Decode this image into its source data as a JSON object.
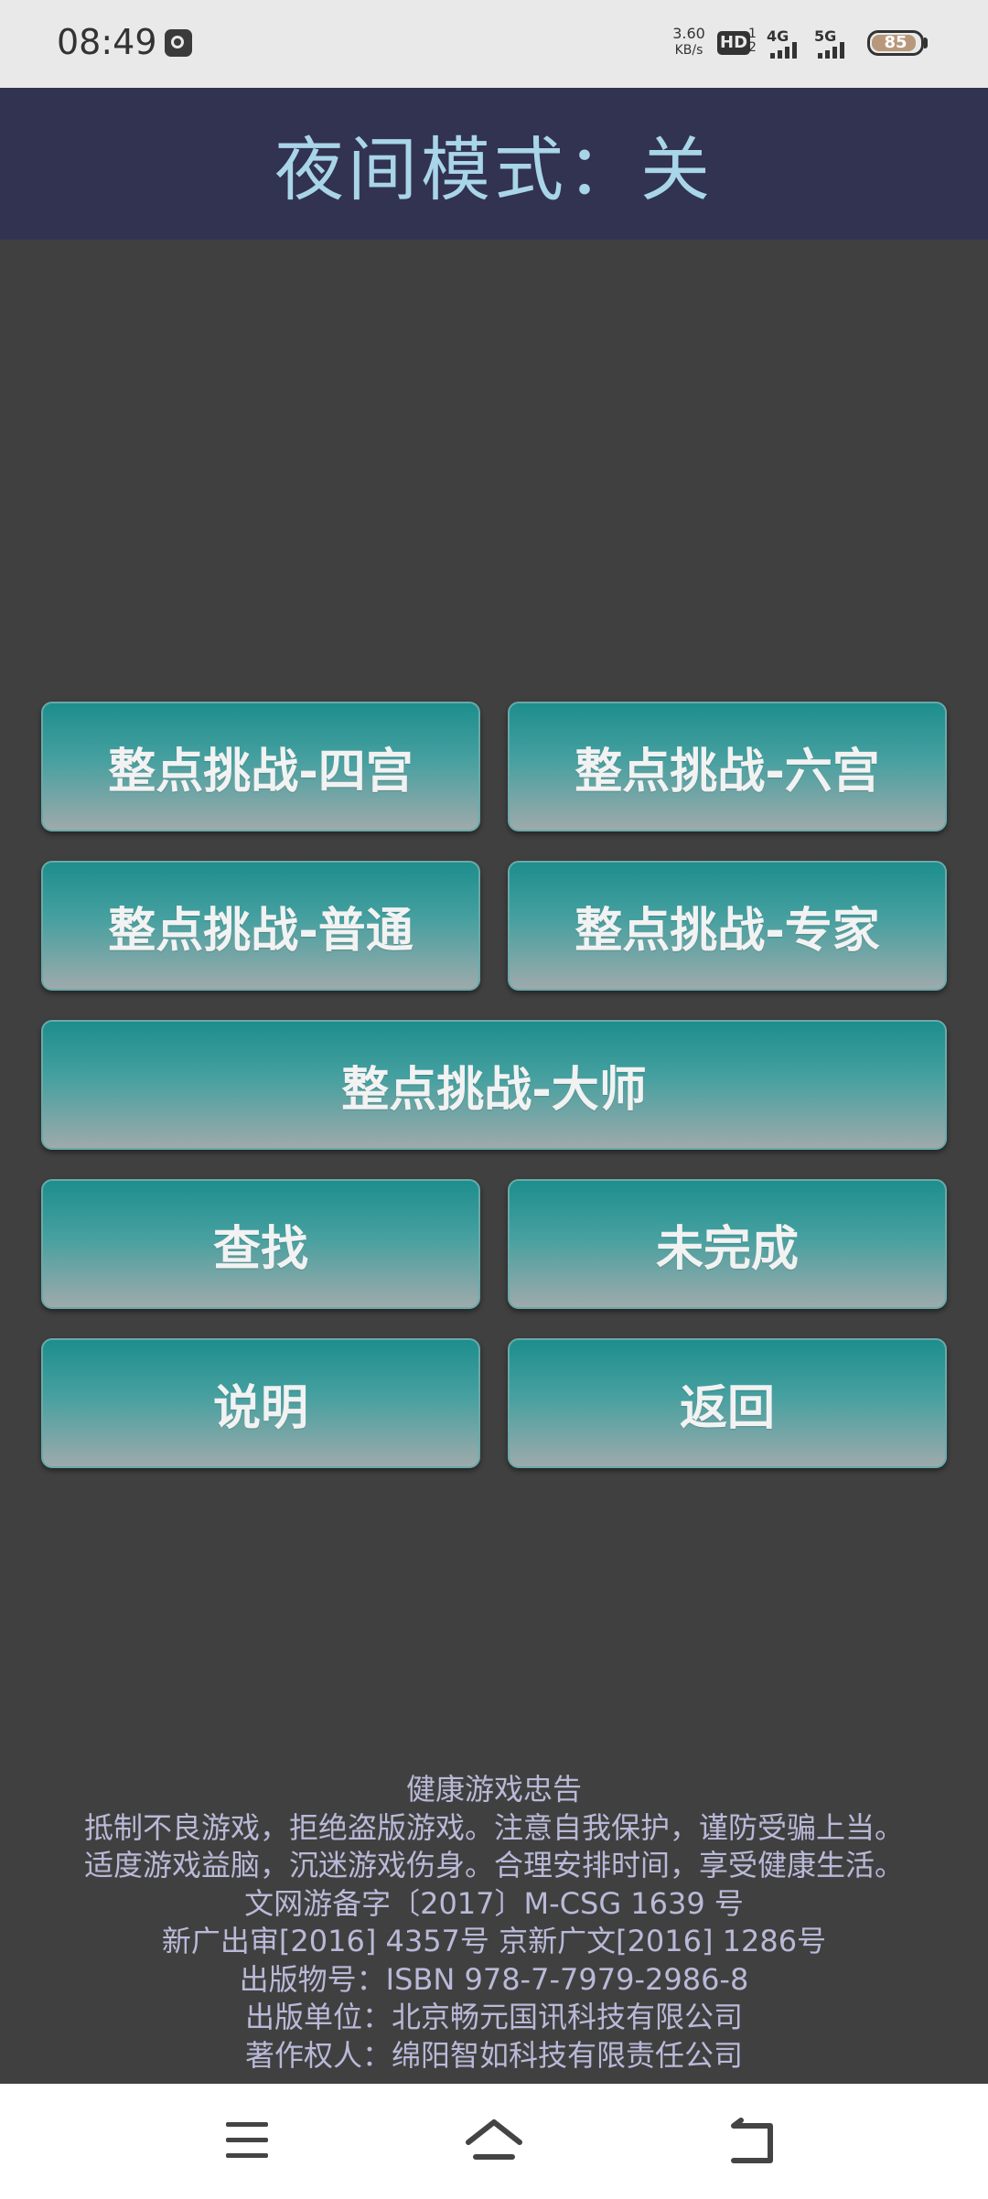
{
  "status_bar": {
    "time": "08:49",
    "net_speed_value": "3.60",
    "net_speed_unit": "KB/s",
    "hd_label": "HD",
    "hd_sub": "1\n2",
    "signal_4g": "4G",
    "signal_5g": "5G",
    "battery": "85",
    "app_icon": "gallery-icon"
  },
  "header": {
    "title": "夜间模式：关",
    "bg_color": "#323251",
    "title_color": "#a9d5e8"
  },
  "buttons": {
    "four_palace": "整点挑战-四宫",
    "six_palace": "整点挑战-六宫",
    "normal": "整点挑战-普通",
    "expert": "整点挑战-专家",
    "master": "整点挑战-大师",
    "search": "查找",
    "unfinished": "未完成",
    "instructions": "说明",
    "back": "返回"
  },
  "footer": {
    "lines": [
      "健康游戏忠告",
      "抵制不良游戏，拒绝盗版游戏。注意自我保护，谨防受骗上当。",
      "适度游戏益脑，沉迷游戏伤身。合理安排时间，享受健康生活。",
      "文网游备字〔2017〕M-CSG 1639 号",
      "新广出审[2016] 4357号 京新广文[2016] 1286号",
      "出版物号：ISBN 978-7-7979-2986-8",
      "出版单位：北京畅元国讯科技有限公司",
      "著作权人：绵阳智如科技有限责任公司"
    ]
  },
  "nav_bar": {
    "menu": "menu-icon",
    "home": "home-icon",
    "back": "back-icon"
  },
  "colors": {
    "background": "#404040",
    "button_top": "#1d8e8d",
    "button_bottom": "#9eaaab",
    "footer_text": "#b9b9d8"
  }
}
